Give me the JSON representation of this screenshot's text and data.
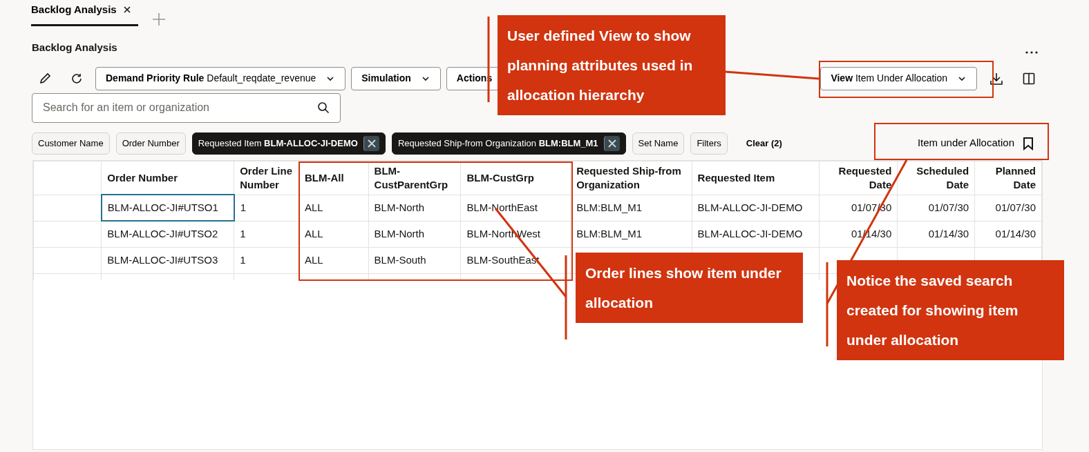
{
  "tabs": [
    {
      "label": "Backlog Analysis",
      "selected": true
    }
  ],
  "page_title": "Backlog Analysis",
  "toolbar": {
    "demand_rule": {
      "label": "Demand Priority Rule",
      "value": "Default_reqdate_revenue"
    },
    "menus": [
      {
        "label": "Simulation",
        "caret": true
      },
      {
        "label": "Actions",
        "caret": false
      }
    ],
    "view": {
      "label": "View",
      "value": "Item Under Allocation"
    }
  },
  "search": {
    "placeholder": "Search for an item or organization"
  },
  "filters": [
    {
      "label": "Customer Name",
      "applied": false
    },
    {
      "label": "Order Number",
      "applied": false
    },
    {
      "label": "Requested Item",
      "value": "BLM-ALLOC-JI-DEMO",
      "applied": true
    },
    {
      "label": "Requested Ship-from Organization",
      "value": "BLM:BLM_M1",
      "applied": true
    },
    {
      "label": "Set Name",
      "applied": false
    },
    {
      "label": "Filters",
      "applied": false
    }
  ],
  "clear": "Clear (2)",
  "saved_search": "Item under Allocation",
  "table": {
    "columns": [
      {
        "label": "Order Number",
        "kind": "text"
      },
      {
        "label": "Order Line Number",
        "kind": "text"
      },
      {
        "label": "BLM-All",
        "kind": "text"
      },
      {
        "label": "BLM-CustParentGrp",
        "kind": "text"
      },
      {
        "label": "BLM-CustGrp",
        "kind": "text"
      },
      {
        "label": "Requested Ship-from Organization",
        "kind": "text"
      },
      {
        "label": "Requested Item",
        "kind": "text"
      },
      {
        "label": "Requested Date",
        "kind": "date"
      },
      {
        "label": "Scheduled Date",
        "kind": "date"
      },
      {
        "label": "Planned Date",
        "kind": "date"
      }
    ],
    "rows": [
      {
        "focused": true,
        "cells": [
          "BLM-ALLOC-JI#UTSO1",
          "1",
          "ALL",
          "BLM-North",
          "BLM-NorthEast",
          "BLM:BLM_M1",
          "BLM-ALLOC-JI-DEMO",
          "01/07/30",
          "01/07/30",
          "01/07/30"
        ]
      },
      {
        "focused": false,
        "cells": [
          "BLM-ALLOC-JI#UTSO2",
          "1",
          "ALL",
          "BLM-North",
          "BLM-NorthWest",
          "BLM:BLM_M1",
          "BLM-ALLOC-JI-DEMO",
          "01/14/30",
          "01/14/30",
          "01/14/30"
        ]
      },
      {
        "focused": false,
        "cells": [
          "BLM-ALLOC-JI#UTSO3",
          "1",
          "ALL",
          "BLM-South",
          "BLM-SouthEast",
          null,
          null,
          null,
          null,
          null
        ]
      }
    ]
  },
  "callouts": [
    {
      "text": "User defined View to show planning attributes used in allocation hierarchy"
    },
    {
      "text": "Order lines show item under allocation"
    },
    {
      "text": "Notice the saved search created for showing item under allocation"
    }
  ]
}
